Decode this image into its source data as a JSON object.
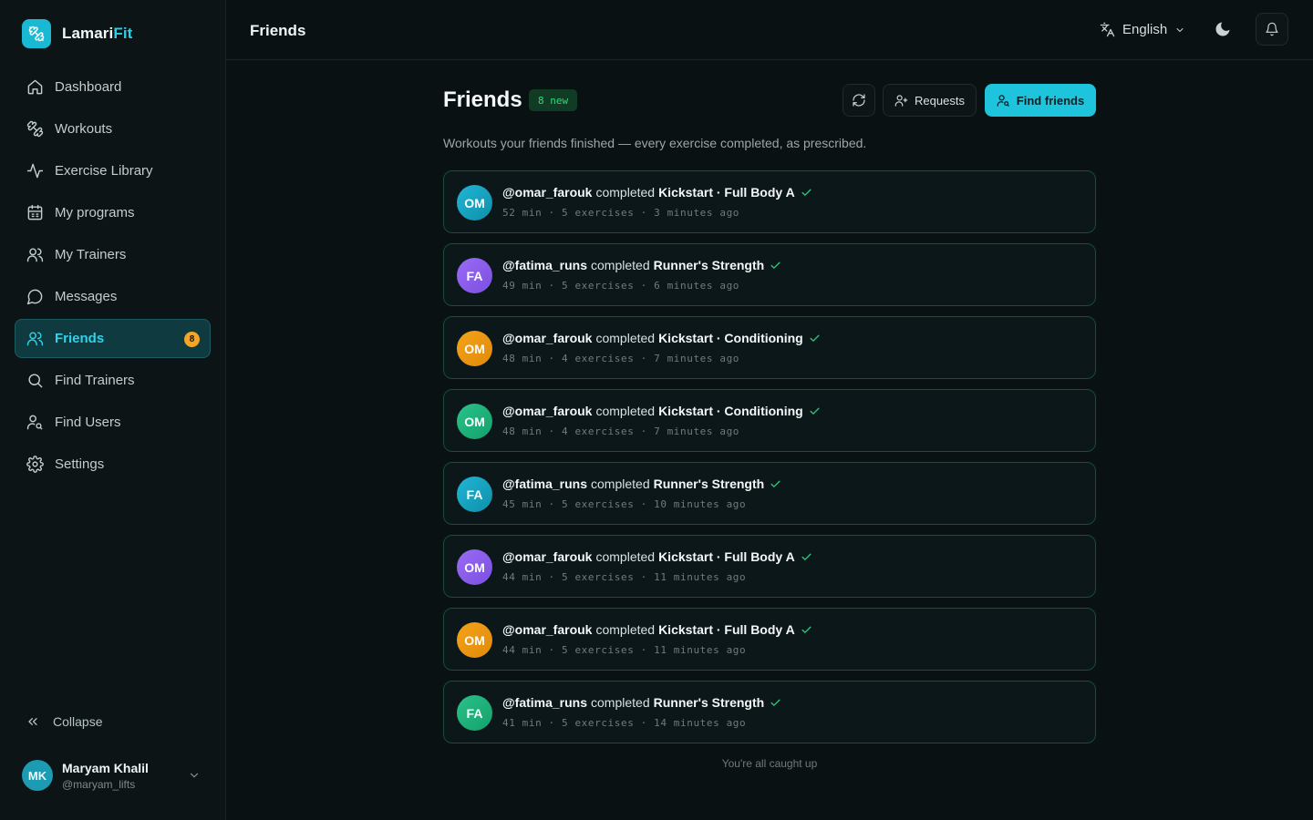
{
  "app": {
    "name_main": "Lamari",
    "name_accent": "Fit",
    "accent": "#1ec3dc"
  },
  "sidebar": {
    "items": [
      {
        "label": "Dashboard",
        "icon": "home-icon"
      },
      {
        "label": "Workouts",
        "icon": "dumbbell-icon"
      },
      {
        "label": "Exercise Library",
        "icon": "activity-icon"
      },
      {
        "label": "My programs",
        "icon": "calendar-icon"
      },
      {
        "label": "My Trainers",
        "icon": "users-icon"
      },
      {
        "label": "Messages",
        "icon": "message-circle-icon"
      },
      {
        "label": "Friends",
        "icon": "user-icon",
        "active": true,
        "badge": "8"
      },
      {
        "label": "Find Trainers",
        "icon": "search-icon"
      },
      {
        "label": "Find Users",
        "icon": "user-search-icon"
      },
      {
        "label": "Settings",
        "icon": "gear-icon"
      }
    ],
    "collapse_label": "Collapse",
    "user": {
      "initials": "MK",
      "name": "Maryam Khalil",
      "handle": "@maryam_lifts"
    }
  },
  "topbar": {
    "title": "Friends",
    "language": "English"
  },
  "main": {
    "title": "Friends",
    "new_badge": "8 new",
    "requests_label": "Requests",
    "find_friends_label": "Find friends",
    "subtitle": "Workouts your friends finished — every exercise completed, as prescribed.",
    "verb": "completed",
    "feed": [
      {
        "initials": "OM",
        "color": "cyan",
        "handle": "@omar_farouk",
        "workout": "Kickstart · Full Body A",
        "meta": "52 min · 5 exercises · 3 minutes ago"
      },
      {
        "initials": "FA",
        "color": "purple",
        "handle": "@fatima_runs",
        "workout": "Runner's Strength",
        "meta": "49 min · 5 exercises · 6 minutes ago"
      },
      {
        "initials": "OM",
        "color": "orange",
        "handle": "@omar_farouk",
        "workout": "Kickstart · Conditioning",
        "meta": "48 min · 4 exercises · 7 minutes ago"
      },
      {
        "initials": "OM",
        "color": "green",
        "handle": "@omar_farouk",
        "workout": "Kickstart · Conditioning",
        "meta": "48 min · 4 exercises · 7 minutes ago"
      },
      {
        "initials": "FA",
        "color": "cyan",
        "handle": "@fatima_runs",
        "workout": "Runner's Strength",
        "meta": "45 min · 5 exercises · 10 minutes ago"
      },
      {
        "initials": "OM",
        "color": "purple",
        "handle": "@omar_farouk",
        "workout": "Kickstart · Full Body A",
        "meta": "44 min · 5 exercises · 11 minutes ago"
      },
      {
        "initials": "OM",
        "color": "orange",
        "handle": "@omar_farouk",
        "workout": "Kickstart · Full Body A",
        "meta": "44 min · 5 exercises · 11 minutes ago"
      },
      {
        "initials": "FA",
        "color": "green",
        "handle": "@fatima_runs",
        "workout": "Runner's Strength",
        "meta": "41 min · 5 exercises · 14 minutes ago"
      }
    ],
    "footer": "You're all caught up"
  }
}
